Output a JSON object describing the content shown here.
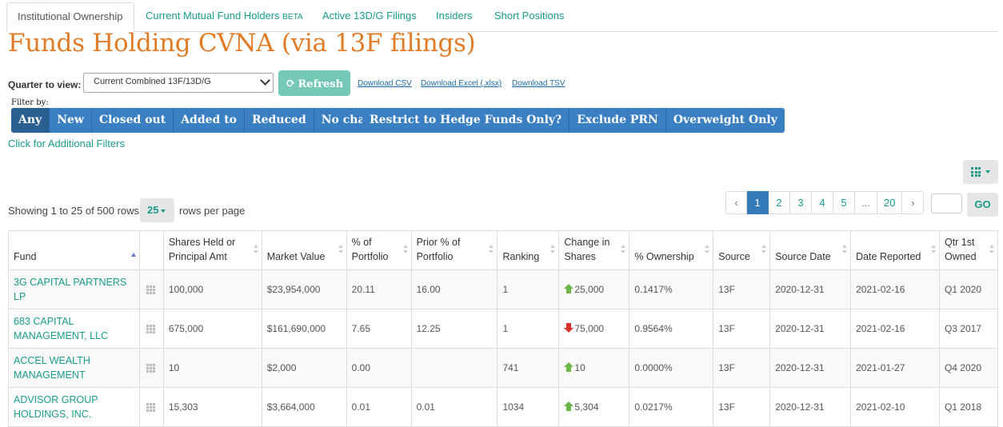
{
  "tabs": [
    {
      "label": "Institutional Ownership",
      "active": true
    },
    {
      "label": "Current Mutual Fund Holders",
      "badge": "BETA"
    },
    {
      "label": "Active 13D/G Filings"
    },
    {
      "label": "Insiders"
    },
    {
      "label": "Short Positions"
    }
  ],
  "page_title": "Funds Holding CVNA (via 13F filings)",
  "quarter": {
    "label": "Quarter to view:",
    "selected": "Current Combined 13F/13D/G"
  },
  "refresh_label": "Refresh",
  "downloads": [
    "Download CSV",
    "Download Excel (.xlsx)",
    "Download TSV"
  ],
  "filter": {
    "label": "Filter by:",
    "group1": [
      "Any",
      "New",
      "Closed out",
      "Added to",
      "Reduced",
      "No change"
    ],
    "group2": [
      "Restrict to Hedge Funds Only?",
      "Exclude PRN",
      "Overweight Only"
    ],
    "active": "Any"
  },
  "additional_filters": "Click for Additional Filters",
  "showing": "Showing 1 to 25 of 500 rows",
  "rows_per_page": {
    "value": "25",
    "suffix": "rows per page"
  },
  "pagination": {
    "prev": "‹",
    "pages": [
      "1",
      "2",
      "3",
      "4",
      "5",
      "...",
      "20"
    ],
    "next": "›",
    "active": "1",
    "go": "GO"
  },
  "table": {
    "headers": [
      "Fund",
      "",
      "Shares Held or Principal Amt",
      "Market Value",
      "% of Portfolio",
      "Prior % of Portfolio",
      "Ranking",
      "Change in Shares",
      "% Ownership",
      "Source",
      "Source Date",
      "Date Reported",
      "Qtr 1st Owned"
    ],
    "rows": [
      {
        "fund": "3G CAPITAL PARTNERS LP",
        "shares": "100,000",
        "market_value": "$23,954,000",
        "pct": "20.11",
        "prior_pct": "16.00",
        "ranking": "1",
        "change": "25,000",
        "change_dir": "up",
        "ownership": "0.1417%",
        "source": "13F",
        "source_date": "2020-12-31",
        "date_reported": "2021-02-16",
        "qtr_first": "Q1 2020"
      },
      {
        "fund": "683 CAPITAL MANAGEMENT, LLC",
        "shares": "675,000",
        "market_value": "$161,690,000",
        "pct": "7.65",
        "prior_pct": "12.25",
        "ranking": "1",
        "change": "75,000",
        "change_dir": "down",
        "ownership": "0.9564%",
        "source": "13F",
        "source_date": "2020-12-31",
        "date_reported": "2021-02-16",
        "qtr_first": "Q3 2017"
      },
      {
        "fund": "ACCEL WEALTH MANAGEMENT",
        "shares": "10",
        "market_value": "$2,000",
        "pct": "0.00",
        "prior_pct": "",
        "ranking": "741",
        "change": "10",
        "change_dir": "up",
        "ownership": "0.0000%",
        "source": "13F",
        "source_date": "2020-12-31",
        "date_reported": "2021-01-27",
        "qtr_first": "Q4 2020"
      },
      {
        "fund": "ADVISOR GROUP HOLDINGS, INC.",
        "shares": "15,303",
        "market_value": "$3,664,000",
        "pct": "0.01",
        "prior_pct": "0.01",
        "ranking": "1034",
        "change": "5,304",
        "change_dir": "up",
        "ownership": "0.0217%",
        "source": "13F",
        "source_date": "2020-12-31",
        "date_reported": "2021-02-10",
        "qtr_first": "Q1 2018"
      }
    ]
  },
  "colors": {
    "accent": "#1a9b8c",
    "title": "#e07b28",
    "filter_button": "#3a7fc1",
    "active_page": "#337ab7"
  }
}
